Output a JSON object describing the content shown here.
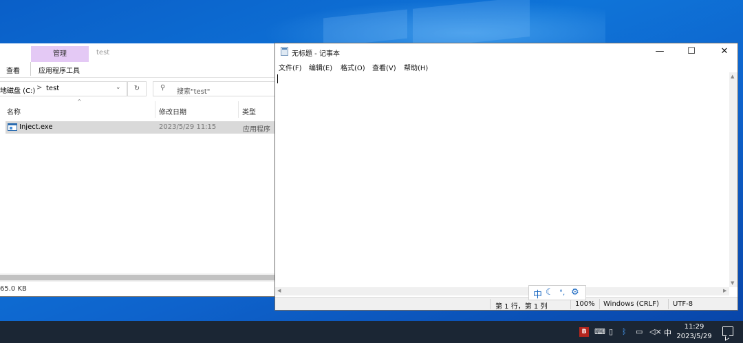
{
  "explorer": {
    "context_tab": "管理",
    "title": "test",
    "ribbon_tabs": [
      "查看",
      "应用程序工具"
    ],
    "address": {
      "drive": "地磁盘 (C:)",
      "arrow": ">",
      "folder": "test"
    },
    "search_placeholder": "搜索\"test\"",
    "columns": [
      "名称",
      "修改日期",
      "类型"
    ],
    "files": [
      {
        "name": "Inject.exe",
        "date": "2023/5/29 11:15",
        "type": "应用程序"
      }
    ],
    "status": "65.0 KB"
  },
  "notepad": {
    "title": "无标题 - 记事本",
    "menu": [
      "文件(F)",
      "编辑(E)",
      "格式(O)",
      "查看(V)",
      "帮助(H)"
    ],
    "status": {
      "position": "第 1 行，第 1 列",
      "zoom": "100%",
      "line_ending": "Windows (CRLF)",
      "encoding": "UTF-8"
    }
  },
  "ime": {
    "mode": "中"
  },
  "taskbar": {
    "ime_indicator": "中",
    "time": "11:29",
    "date": "2023/5/29"
  }
}
